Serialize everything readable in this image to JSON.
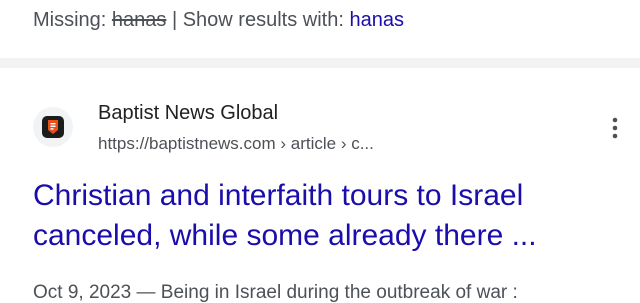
{
  "missing": {
    "prefix": "Missing: ",
    "struck_term": "hanas",
    "separator": " | Show results with: ",
    "show_link": "hanas"
  },
  "result": {
    "favicon_icon": "baptist-news-logo-icon",
    "favicon_color": "#e8501e",
    "site_name": "Baptist News Global",
    "url": "https://baptistnews.com › article › c...",
    "menu_icon": "more-vert-icon",
    "title_line1": "Christian and interfaith tours to Israel",
    "title_line2": "canceled, while some already there ...",
    "snippet": "Oct 9, 2023 — Being in Israel during the outbreak of war :"
  },
  "colors": {
    "link": "#1a0dab",
    "text_secondary": "#4d5156",
    "divider": "#f1f3f4"
  }
}
